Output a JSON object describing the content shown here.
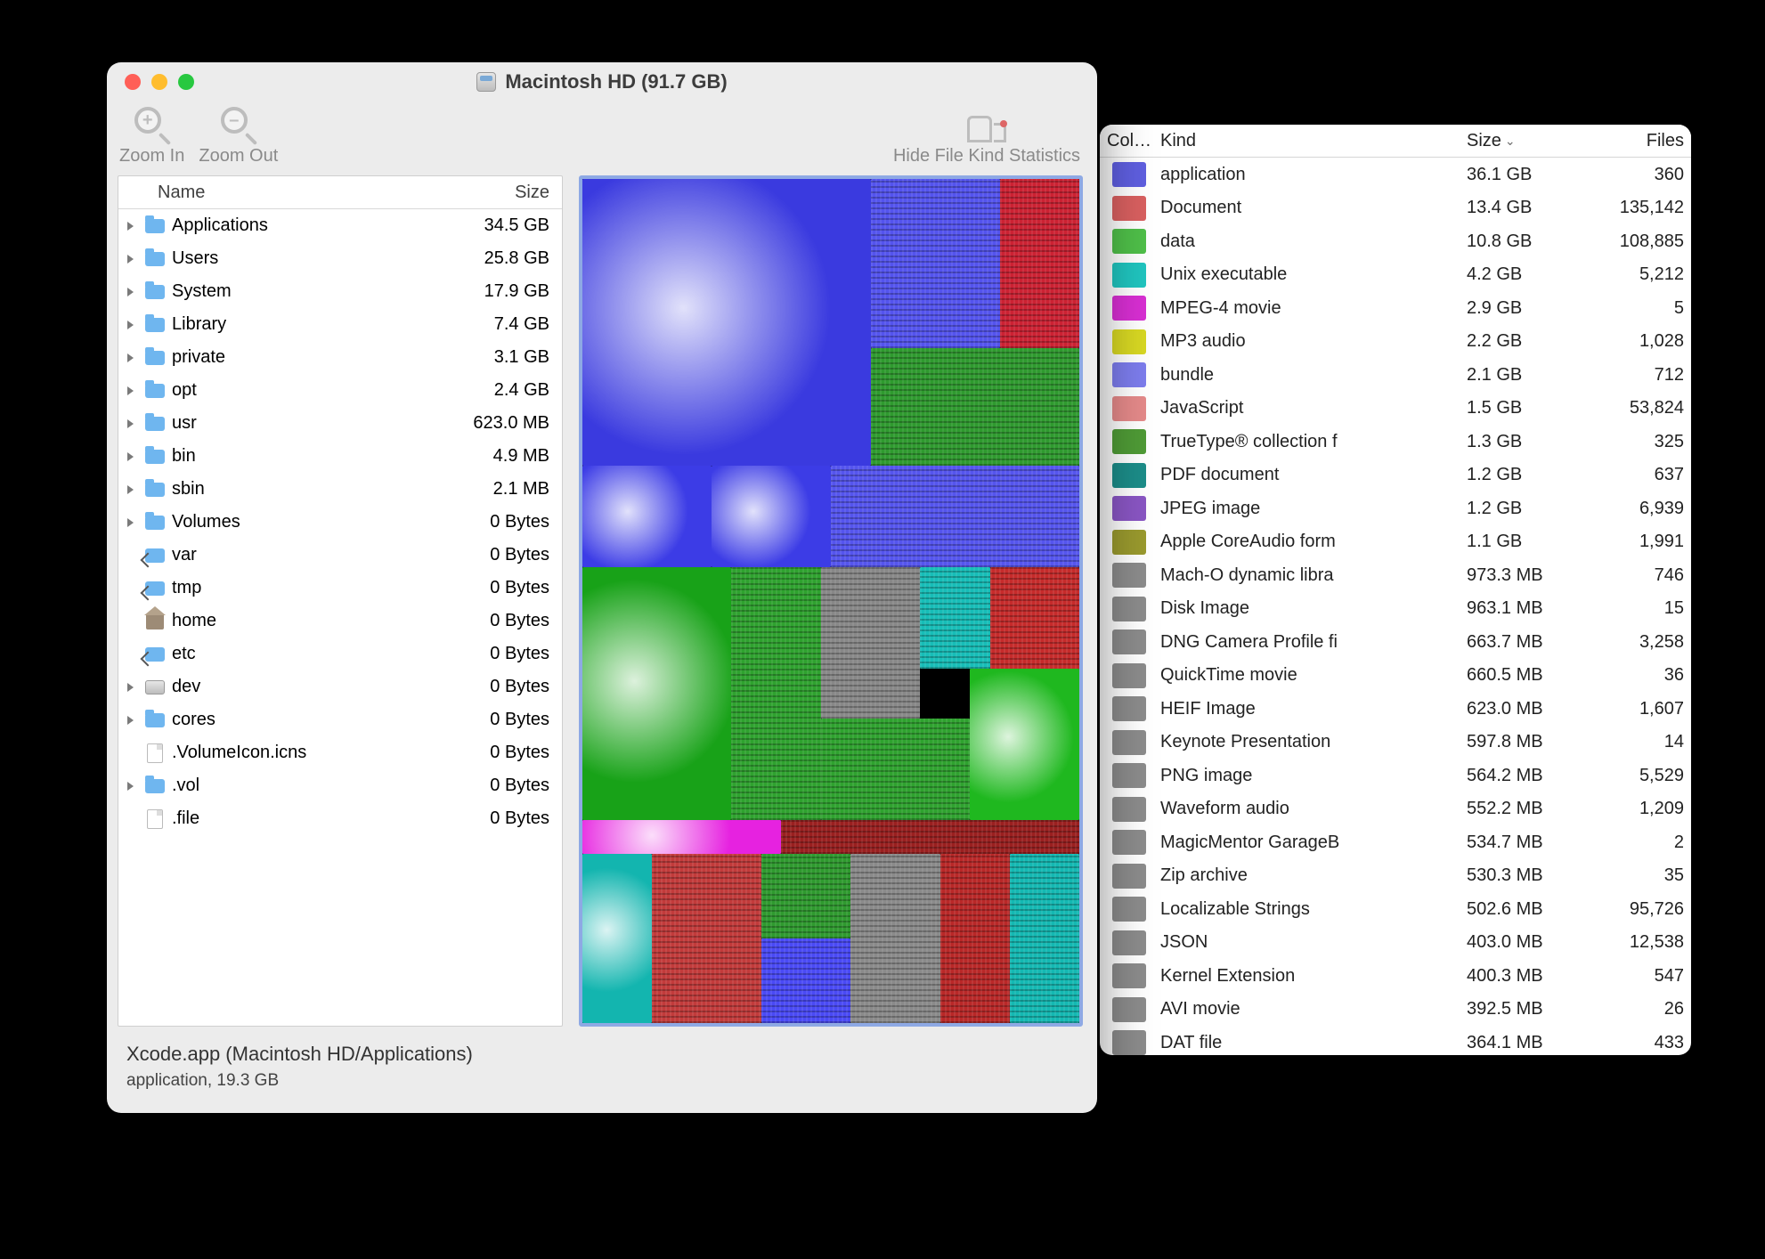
{
  "window": {
    "title": "Macintosh HD (91.7 GB)"
  },
  "toolbar": {
    "zoom_in": "Zoom In",
    "zoom_out": "Zoom Out",
    "hide_stats": "Hide File Kind Statistics"
  },
  "tree": {
    "header_name": "Name",
    "header_size": "Size",
    "rows": [
      {
        "expandable": true,
        "icon": "folder",
        "name": "Applications",
        "size": "34.5 GB"
      },
      {
        "expandable": true,
        "icon": "folder",
        "name": "Users",
        "size": "25.8 GB"
      },
      {
        "expandable": true,
        "icon": "folder",
        "name": "System",
        "size": "17.9 GB"
      },
      {
        "expandable": true,
        "icon": "folder",
        "name": "Library",
        "size": "7.4 GB"
      },
      {
        "expandable": true,
        "icon": "folder",
        "name": "private",
        "size": "3.1 GB"
      },
      {
        "expandable": true,
        "icon": "folder",
        "name": "opt",
        "size": "2.4 GB"
      },
      {
        "expandable": true,
        "icon": "folder",
        "name": "usr",
        "size": "623.0 MB"
      },
      {
        "expandable": true,
        "icon": "folder",
        "name": "bin",
        "size": "4.9 MB"
      },
      {
        "expandable": true,
        "icon": "folder",
        "name": "sbin",
        "size": "2.1 MB"
      },
      {
        "expandable": true,
        "icon": "folder",
        "name": "Volumes",
        "size": "0 Bytes"
      },
      {
        "expandable": false,
        "icon": "alias",
        "name": "var",
        "size": "0 Bytes"
      },
      {
        "expandable": false,
        "icon": "alias",
        "name": "tmp",
        "size": "0 Bytes"
      },
      {
        "expandable": false,
        "icon": "home",
        "name": "home",
        "size": "0 Bytes"
      },
      {
        "expandable": false,
        "icon": "alias",
        "name": "etc",
        "size": "0 Bytes"
      },
      {
        "expandable": true,
        "icon": "disk",
        "name": "dev",
        "size": "0 Bytes"
      },
      {
        "expandable": true,
        "icon": "folder",
        "name": "cores",
        "size": "0 Bytes"
      },
      {
        "expandable": false,
        "icon": "file",
        "name": ".VolumeIcon.icns",
        "size": "0 Bytes"
      },
      {
        "expandable": true,
        "icon": "folder",
        "name": ".vol",
        "size": "0 Bytes"
      },
      {
        "expandable": false,
        "icon": "file",
        "name": ".file",
        "size": "0 Bytes"
      }
    ]
  },
  "footer": {
    "path": "Xcode.app (Macintosh HD/Applications)",
    "detail": "application, 19.3 GB"
  },
  "stats": {
    "header_color": "Col…",
    "header_kind": "Kind",
    "header_size": "Size",
    "header_files": "Files",
    "rows": [
      {
        "color": "#5f5fe0",
        "kind": "application",
        "size": "36.1 GB",
        "files": "360"
      },
      {
        "color": "#d96060",
        "kind": "Document",
        "size": "13.4 GB",
        "files": "135,142"
      },
      {
        "color": "#4fbf49",
        "kind": "data",
        "size": "10.8 GB",
        "files": "108,885"
      },
      {
        "color": "#20c5bf",
        "kind": "Unix executable",
        "size": "4.2 GB",
        "files": "5,212"
      },
      {
        "color": "#d82fd3",
        "kind": "MPEG-4 movie",
        "size": "2.9 GB",
        "files": "5"
      },
      {
        "color": "#d8d823",
        "kind": "MP3 audio",
        "size": "2.2 GB",
        "files": "1,028"
      },
      {
        "color": "#7d7ded",
        "kind": "bundle",
        "size": "2.1 GB",
        "files": "712"
      },
      {
        "color": "#e58a8a",
        "kind": "JavaScript",
        "size": "1.5 GB",
        "files": "53,824"
      },
      {
        "color": "#4f9b36",
        "kind": "TrueType® collection f",
        "size": "1.3 GB",
        "files": "325"
      },
      {
        "color": "#1c8d89",
        "kind": "PDF document",
        "size": "1.2 GB",
        "files": "637"
      },
      {
        "color": "#8a56c4",
        "kind": "JPEG image",
        "size": "1.2 GB",
        "files": "6,939"
      },
      {
        "color": "#9a9a2e",
        "kind": "Apple CoreAudio form",
        "size": "1.1 GB",
        "files": "1,991"
      },
      {
        "color": "#8c8c8c",
        "kind": "Mach-O dynamic libra",
        "size": "973.3 MB",
        "files": "746"
      },
      {
        "color": "#8c8c8c",
        "kind": "Disk Image",
        "size": "963.1 MB",
        "files": "15"
      },
      {
        "color": "#8c8c8c",
        "kind": "DNG Camera Profile fi",
        "size": "663.7 MB",
        "files": "3,258"
      },
      {
        "color": "#8c8c8c",
        "kind": "QuickTime movie",
        "size": "660.5 MB",
        "files": "36"
      },
      {
        "color": "#8c8c8c",
        "kind": "HEIF Image",
        "size": "623.0 MB",
        "files": "1,607"
      },
      {
        "color": "#8c8c8c",
        "kind": "Keynote Presentation",
        "size": "597.8 MB",
        "files": "14"
      },
      {
        "color": "#8c8c8c",
        "kind": "PNG image",
        "size": "564.2 MB",
        "files": "5,529"
      },
      {
        "color": "#8c8c8c",
        "kind": "Waveform audio",
        "size": "552.2 MB",
        "files": "1,209"
      },
      {
        "color": "#8c8c8c",
        "kind": "MagicMentor GarageB",
        "size": "534.7 MB",
        "files": "2"
      },
      {
        "color": "#8c8c8c",
        "kind": "Zip archive",
        "size": "530.3 MB",
        "files": "35"
      },
      {
        "color": "#8c8c8c",
        "kind": "Localizable Strings",
        "size": "502.6 MB",
        "files": "95,726"
      },
      {
        "color": "#8c8c8c",
        "kind": "JSON",
        "size": "403.0 MB",
        "files": "12,538"
      },
      {
        "color": "#8c8c8c",
        "kind": "Kernel Extension",
        "size": "400.3 MB",
        "files": "547"
      },
      {
        "color": "#8c8c8c",
        "kind": "AVI movie",
        "size": "392.5 MB",
        "files": "26"
      },
      {
        "color": "#8c8c8c",
        "kind": "DAT file",
        "size": "364.1 MB",
        "files": "433"
      }
    ]
  }
}
